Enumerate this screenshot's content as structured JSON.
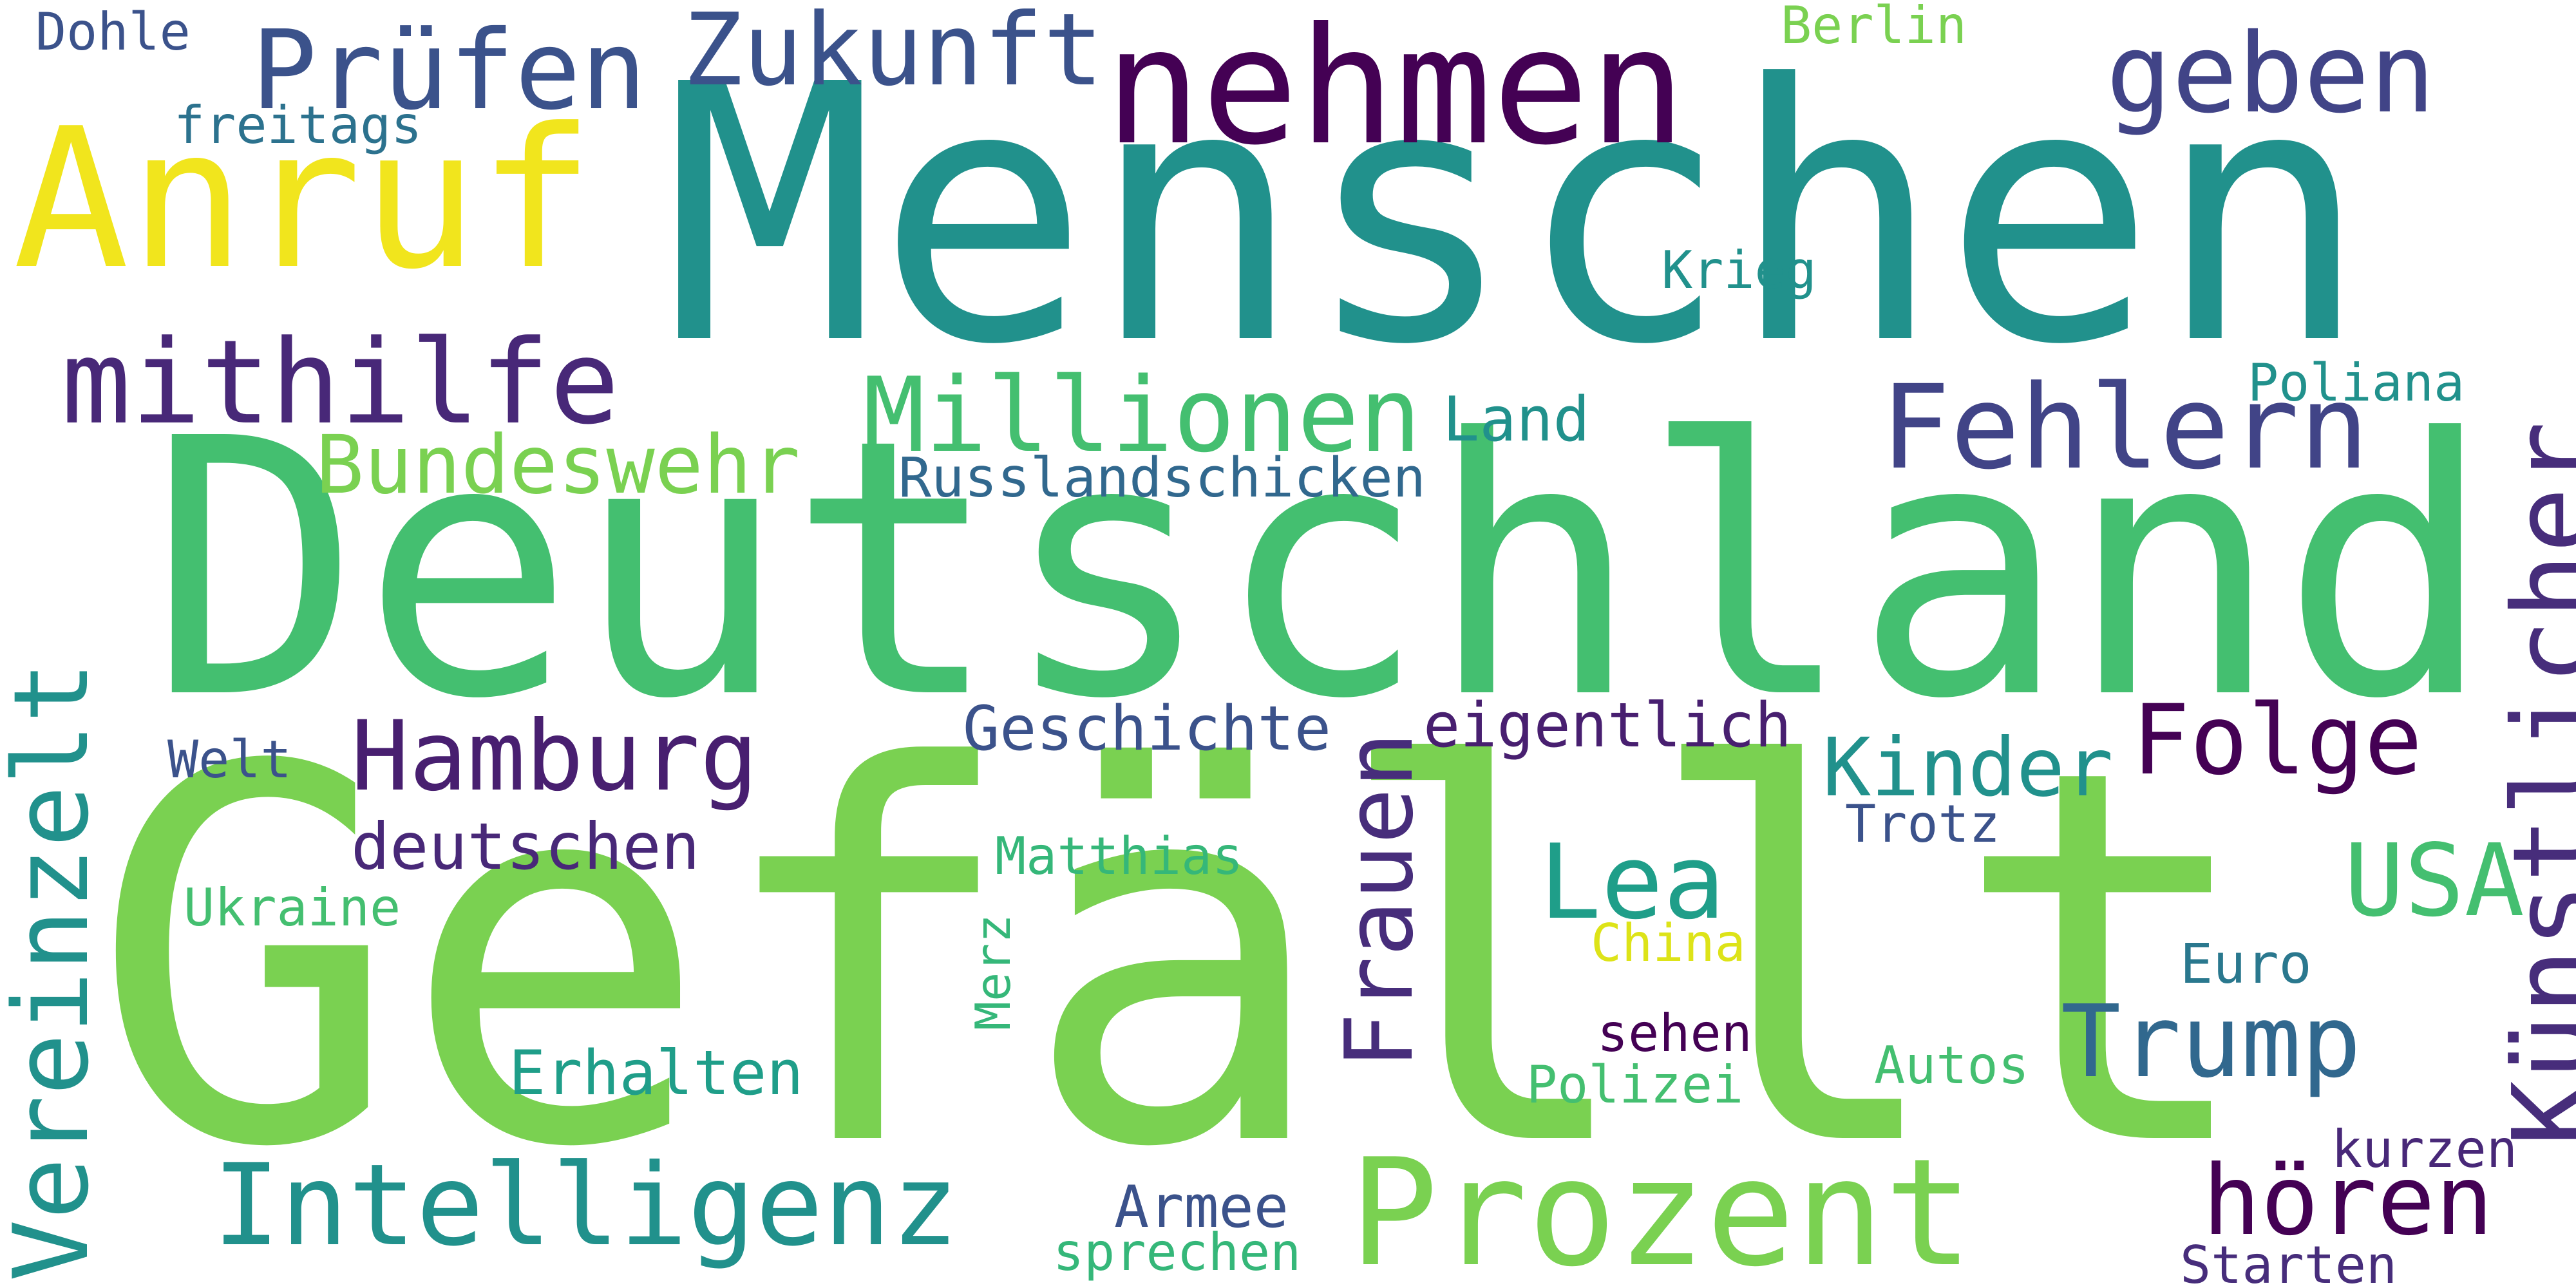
{
  "words": [
    {
      "text": "Gefällt",
      "color": "#7ad151"
    },
    {
      "text": "Deutschland",
      "color": "#44bf70"
    },
    {
      "text": "Menschen",
      "color": "#21918c"
    },
    {
      "text": "nehmen",
      "color": "#440154"
    },
    {
      "text": "Anruf",
      "color": "#f1e51d"
    },
    {
      "text": "Prüfen",
      "color": "#3b528b"
    },
    {
      "text": "Zukunft",
      "color": "#3b528b"
    },
    {
      "text": "geben",
      "color": "#414487"
    },
    {
      "text": "Dohle",
      "color": "#3b528b"
    },
    {
      "text": "freitags",
      "color": "#2c728e"
    },
    {
      "text": "Berlin",
      "color": "#7ad151"
    },
    {
      "text": "Krieg",
      "color": "#21918c"
    },
    {
      "text": "mithilfe",
      "color": "#482878"
    },
    {
      "text": "Millionen",
      "color": "#44bf70"
    },
    {
      "text": "Fehlern",
      "color": "#414487"
    },
    {
      "text": "Bundeswehr",
      "color": "#7ad151"
    },
    {
      "text": "Land",
      "color": "#21918c"
    },
    {
      "text": "Poliana",
      "color": "#21918c"
    },
    {
      "text": "Russlandschicken",
      "color": "#31688e"
    },
    {
      "text": "Künstlicher",
      "color": "#472d7b"
    },
    {
      "text": "Vereinzelt",
      "color": "#21918c"
    },
    {
      "text": "Hamburg",
      "color": "#481f70"
    },
    {
      "text": "Welt",
      "color": "#3b528b"
    },
    {
      "text": "Geschichte",
      "color": "#3b528b"
    },
    {
      "text": "eigentlich",
      "color": "#481f70"
    },
    {
      "text": "Frauen",
      "color": "#472d7b"
    },
    {
      "text": "Kinder",
      "color": "#21918c"
    },
    {
      "text": "Folge",
      "color": "#440154"
    },
    {
      "text": "deutschen",
      "color": "#482878"
    },
    {
      "text": "Trotz",
      "color": "#3b528b"
    },
    {
      "text": "Lea",
      "color": "#1f9e89"
    },
    {
      "text": "Matthias",
      "color": "#35b779"
    },
    {
      "text": "USA",
      "color": "#44bf70"
    },
    {
      "text": "Ukraine",
      "color": "#44bf70"
    },
    {
      "text": "Merz",
      "color": "#35b779"
    },
    {
      "text": "China",
      "color": "#dde318"
    },
    {
      "text": "Euro",
      "color": "#2a788e"
    },
    {
      "text": "Trump",
      "color": "#31688e"
    },
    {
      "text": "sehen",
      "color": "#440154"
    },
    {
      "text": "Erhalten",
      "color": "#1f9e89"
    },
    {
      "text": "Polizei",
      "color": "#44bf70"
    },
    {
      "text": "Autos",
      "color": "#44bf70"
    },
    {
      "text": "Intelligenz",
      "color": "#21918c"
    },
    {
      "text": "Prozent",
      "color": "#7ad151"
    },
    {
      "text": "hören",
      "color": "#440154"
    },
    {
      "text": "kurzen",
      "color": "#482878"
    },
    {
      "text": "Armee",
      "color": "#3b528b"
    },
    {
      "text": "sprechen",
      "color": "#35b779"
    },
    {
      "text": "Starten",
      "color": "#472d7b"
    }
  ]
}
